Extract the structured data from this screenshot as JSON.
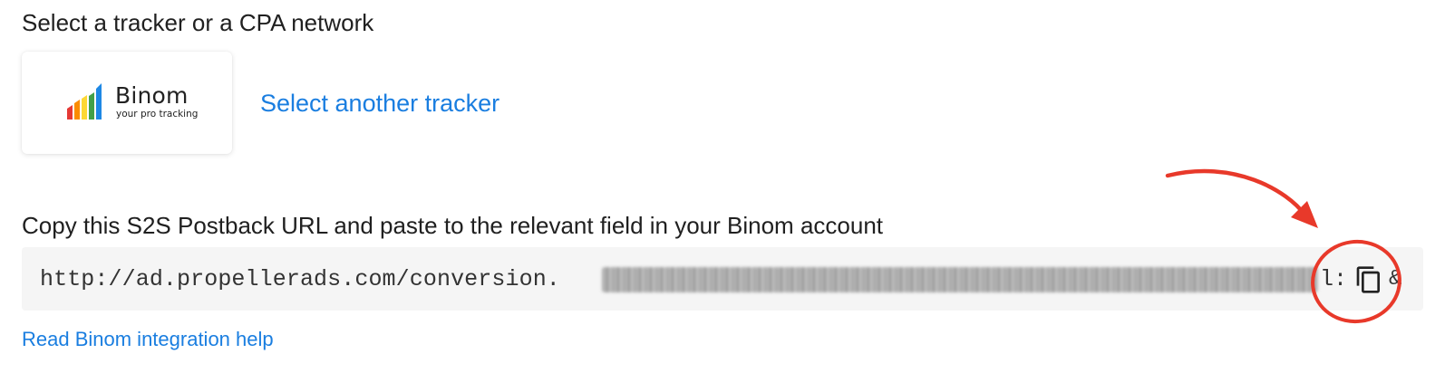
{
  "tracker_section": {
    "heading": "Select a tracker or a CPA network",
    "selected_tracker": {
      "name": "Binom",
      "tagline": "your pro tracking",
      "bar_colors": [
        "#e53935",
        "#fb8c00",
        "#fdd835",
        "#43a047",
        "#1e88e5"
      ]
    },
    "select_another_label": "Select another tracker"
  },
  "postback_section": {
    "heading": "Copy this S2S Postback URL and paste to the relevant field in your Binom account",
    "url_visible_prefix": "http://ad.propellerads.com/conversion.",
    "url_visible_suffix": "l:",
    "url_trailing": "&",
    "copy_icon": "copy-icon",
    "help_link_label": "Read Binom integration help"
  },
  "colors": {
    "link": "#1a7ee0",
    "annotation": "#e8392a",
    "url_box_bg": "#f5f5f5"
  }
}
